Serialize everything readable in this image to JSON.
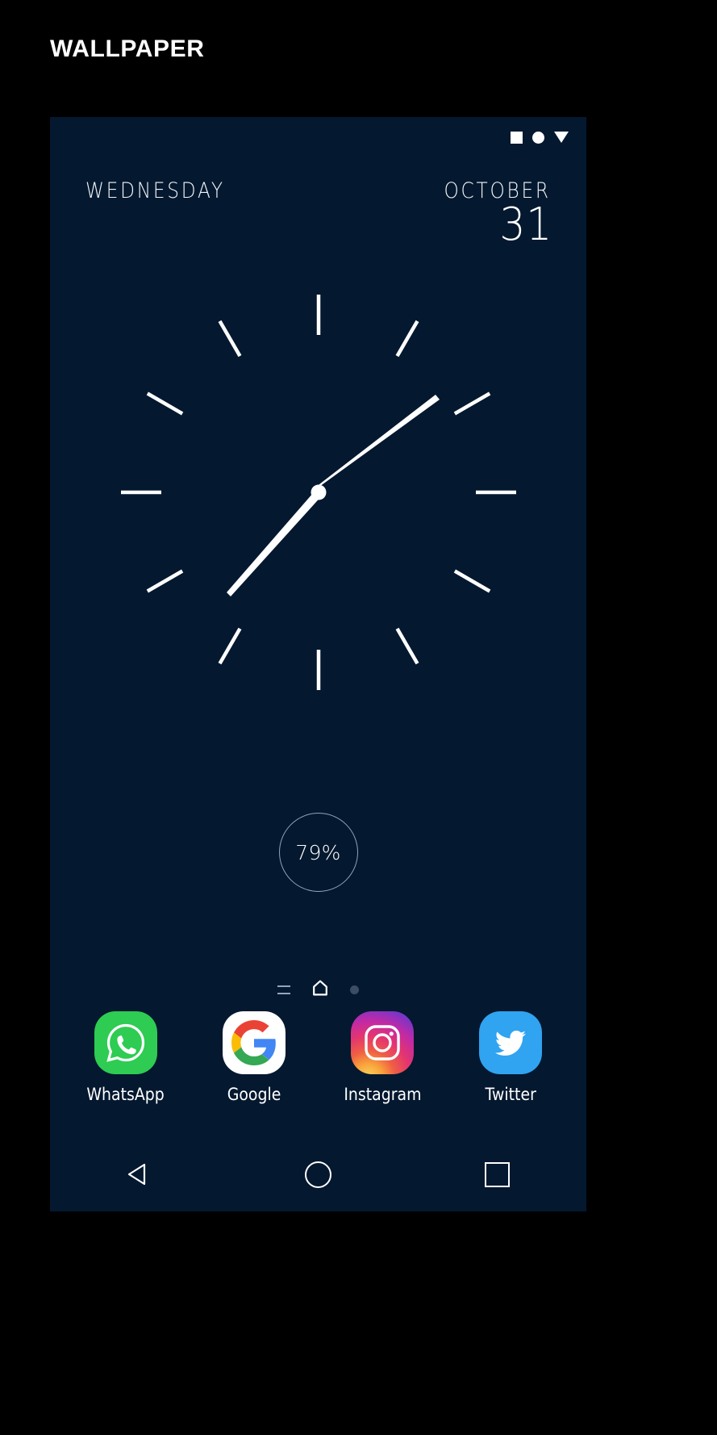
{
  "page": {
    "title": "WALLPAPER",
    "background_color": "#000000"
  },
  "phone": {
    "screen_background_color": "#04182f",
    "status_bar": {
      "icons": [
        "square-icon",
        "circle-icon",
        "triangle-down-icon"
      ]
    },
    "date_widget": {
      "weekday": "WEDNESDAY",
      "month": "OCTOBER",
      "day": "31"
    },
    "clock_widget": {
      "name": "analog-clock",
      "tick_count": 12,
      "hour_hand_angle_deg": 228,
      "minute_hand_angle_deg": 42,
      "hand_color": "#ffffff"
    },
    "battery_widget": {
      "percent_label": "79%",
      "ring_color": "#8fa4bd"
    },
    "page_indicators": [
      {
        "name": "apps-drawer-indicator",
        "icon": "lines-icon",
        "active": false
      },
      {
        "name": "home-page-indicator",
        "icon": "home-icon",
        "active": true
      },
      {
        "name": "secondary-page-indicator",
        "icon": "dot-icon",
        "active": false
      }
    ],
    "dock": [
      {
        "label": "WhatsApp",
        "icon": "whatsapp-icon",
        "color": "#2ecc52"
      },
      {
        "label": "Google",
        "icon": "google-icon",
        "color": "#ffffff"
      },
      {
        "label": "Instagram",
        "icon": "instagram-icon",
        "color": "#c32aa3"
      },
      {
        "label": "Twitter",
        "icon": "twitter-icon",
        "color": "#30a3f1"
      }
    ],
    "nav_bar": [
      {
        "name": "back-button",
        "icon": "triangle-left-icon"
      },
      {
        "name": "home-button",
        "icon": "circle-icon"
      },
      {
        "name": "recents-button",
        "icon": "square-icon"
      }
    ]
  }
}
